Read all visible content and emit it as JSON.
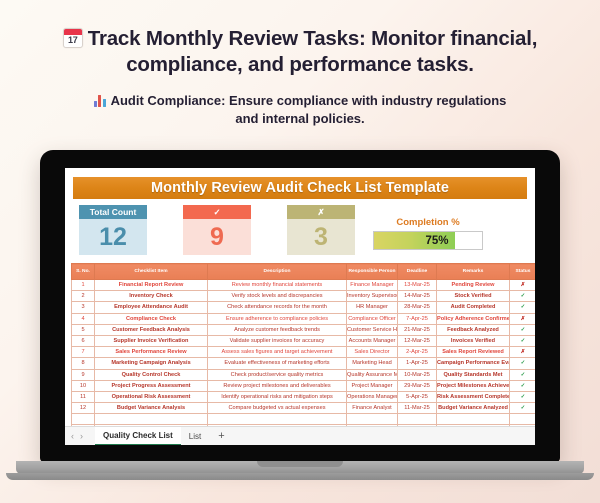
{
  "promo": {
    "calendar_icon": "calendar-icon",
    "calendar_day": "17",
    "headline": "Track Monthly Review Tasks: Monitor financial, compliance, and performance tasks.",
    "chart_icon": "bar-chart-icon",
    "subheadline": "Audit Compliance: Ensure compliance with industry regulations and internal policies."
  },
  "sheet": {
    "title": "Monthly Review Audit Check List Template",
    "kpis": [
      {
        "label": "Total Count",
        "value": "12",
        "head_color": "#4e93b0",
        "body_color": "#d3e6ef"
      },
      {
        "label": "✓",
        "value": "9",
        "head_color": "#f3694f",
        "body_color": "#fbdfd8"
      },
      {
        "label": "✗",
        "value": "3",
        "head_color": "#bcb475",
        "body_color": "#e8e5d2"
      }
    ],
    "completion": {
      "label": "Completion %",
      "value": "75%",
      "percent": 75,
      "fill_color": "#8ece55"
    },
    "columns": [
      "S. No.",
      "Checklist Item",
      "Description",
      "Responsible Person",
      "Deadline",
      "Remarks",
      "Status"
    ],
    "rows": [
      {
        "sno": "1",
        "item": "Financial Report Review",
        "desc": "Review monthly financial statements",
        "resp": "Finance Manager",
        "deadline": "13-Mar-25",
        "remarks": "Pending Review",
        "status": "✗",
        "flag": true
      },
      {
        "sno": "2",
        "item": "Inventory Check",
        "desc": "Verify stock levels and discrepancies",
        "resp": "Inventory Supervisor",
        "deadline": "14-Mar-25",
        "remarks": "Stock Verified",
        "status": "✓",
        "flag": false
      },
      {
        "sno": "3",
        "item": "Employee Attendance Audit",
        "desc": "Check attendance records for the month",
        "resp": "HR Manager",
        "deadline": "28-Mar-25",
        "remarks": "Audit Completed",
        "status": "✓",
        "flag": false
      },
      {
        "sno": "4",
        "item": "Compliance Check",
        "desc": "Ensure adherence to compliance policies",
        "resp": "Compliance Officer",
        "deadline": "7-Apr-25",
        "remarks": "Policy Adherence Confirmed",
        "status": "✗",
        "flag": true
      },
      {
        "sno": "5",
        "item": "Customer Feedback Analysis",
        "desc": "Analyze customer feedback trends",
        "resp": "Customer Service Head",
        "deadline": "21-Mar-25",
        "remarks": "Feedback Analyzed",
        "status": "✓",
        "flag": false
      },
      {
        "sno": "6",
        "item": "Supplier Invoice Verification",
        "desc": "Validate supplier invoices for accuracy",
        "resp": "Accounts Manager",
        "deadline": "12-Mar-25",
        "remarks": "Invoices Verified",
        "status": "✓",
        "flag": false
      },
      {
        "sno": "7",
        "item": "Sales Performance Review",
        "desc": "Assess sales figures and target achievement",
        "resp": "Sales Director",
        "deadline": "2-Apr-25",
        "remarks": "Sales Report Reviewed",
        "status": "✗",
        "flag": true
      },
      {
        "sno": "8",
        "item": "Marketing Campaign Analysis",
        "desc": "Evaluate effectiveness of marketing efforts",
        "resp": "Marketing Head",
        "deadline": "1-Apr-25",
        "remarks": "Campaign Performance Evaluated",
        "status": "✓",
        "flag": false
      },
      {
        "sno": "9",
        "item": "Quality Control Check",
        "desc": "Check product/service quality metrics",
        "resp": "Quality Assurance Manager",
        "deadline": "10-Mar-25",
        "remarks": "Quality Standards Met",
        "status": "✓",
        "flag": false
      },
      {
        "sno": "10",
        "item": "Project Progress Assessment",
        "desc": "Review project milestones and deliverables",
        "resp": "Project Manager",
        "deadline": "29-Mar-25",
        "remarks": "Project Milestones Achieved",
        "status": "✓",
        "flag": false
      },
      {
        "sno": "11",
        "item": "Operational Risk Assessment",
        "desc": "Identify operational risks and mitigation steps",
        "resp": "Operations Manager",
        "deadline": "5-Apr-25",
        "remarks": "Risk Assessment Completed",
        "status": "✓",
        "flag": false
      },
      {
        "sno": "12",
        "item": "Budget Variance Analysis",
        "desc": "Compare budgeted vs actual expenses",
        "resp": "Finance Analyst",
        "deadline": "11-Mar-25",
        "remarks": "Budget Variance Analyzed",
        "status": "✓",
        "flag": false
      }
    ],
    "tabs": {
      "prev_icon": "chevron-left-icon",
      "next_icon": "chevron-right-icon",
      "active": "Quality Check List",
      "second": "List",
      "add": "+"
    }
  }
}
